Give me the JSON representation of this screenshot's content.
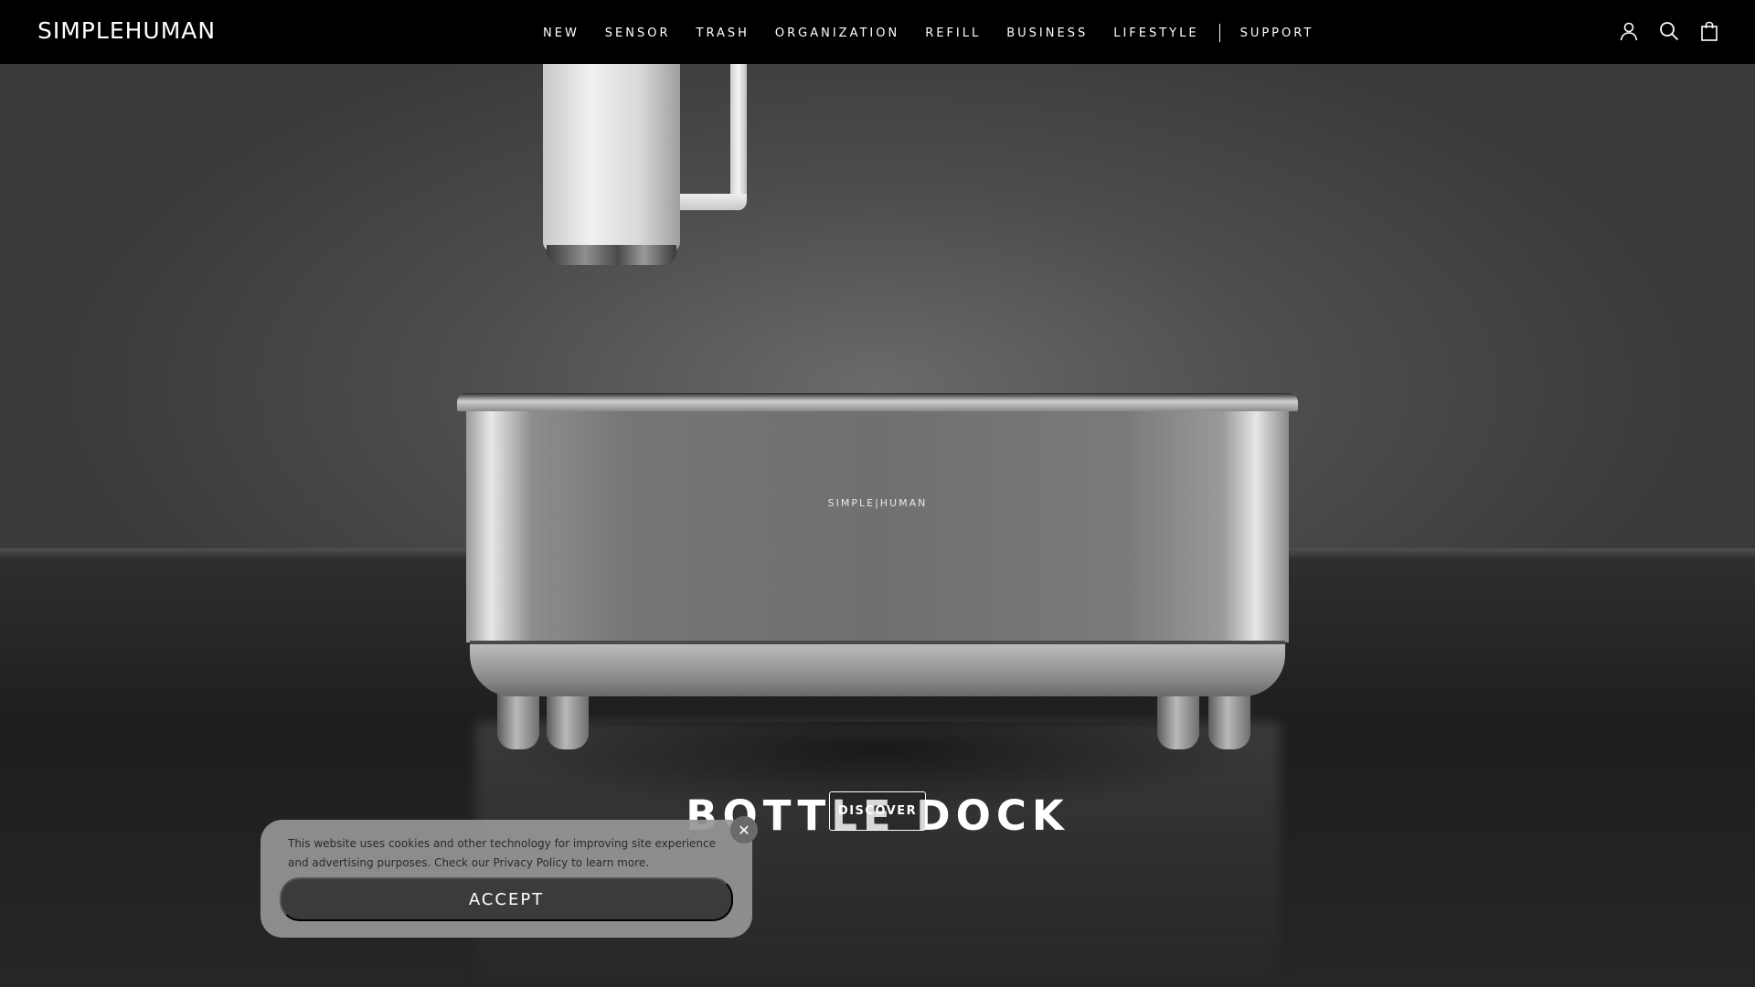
{
  "header": {
    "logo": "SIMPLEHUMAN",
    "nav": [
      {
        "label": "NEW"
      },
      {
        "label": "SENSOR"
      },
      {
        "label": "TRASH"
      },
      {
        "label": "ORGANIZATION"
      },
      {
        "label": "REFILL"
      },
      {
        "label": "BUSINESS"
      },
      {
        "label": "LIFESTYLE"
      }
    ],
    "support_label": "SUPPORT",
    "icons": [
      "account-icon",
      "search-icon",
      "shopping-bag-icon"
    ]
  },
  "hero": {
    "product_brand": "SIMPLE|HUMAN",
    "title": "BOTTLE DOCK",
    "cta_label": "DISCOVER"
  },
  "cookie_banner": {
    "text": "This website uses cookies and other technology for improving site experience and advertising purposes. Check our Privacy Policy to learn more.",
    "accept_label": "ACCEPT",
    "close_label": "✕"
  },
  "colors": {
    "header_bg": "#000000",
    "accent": "#ffffff",
    "cookie_bg": "#969696",
    "accept_bg": "#3b3b3b"
  }
}
